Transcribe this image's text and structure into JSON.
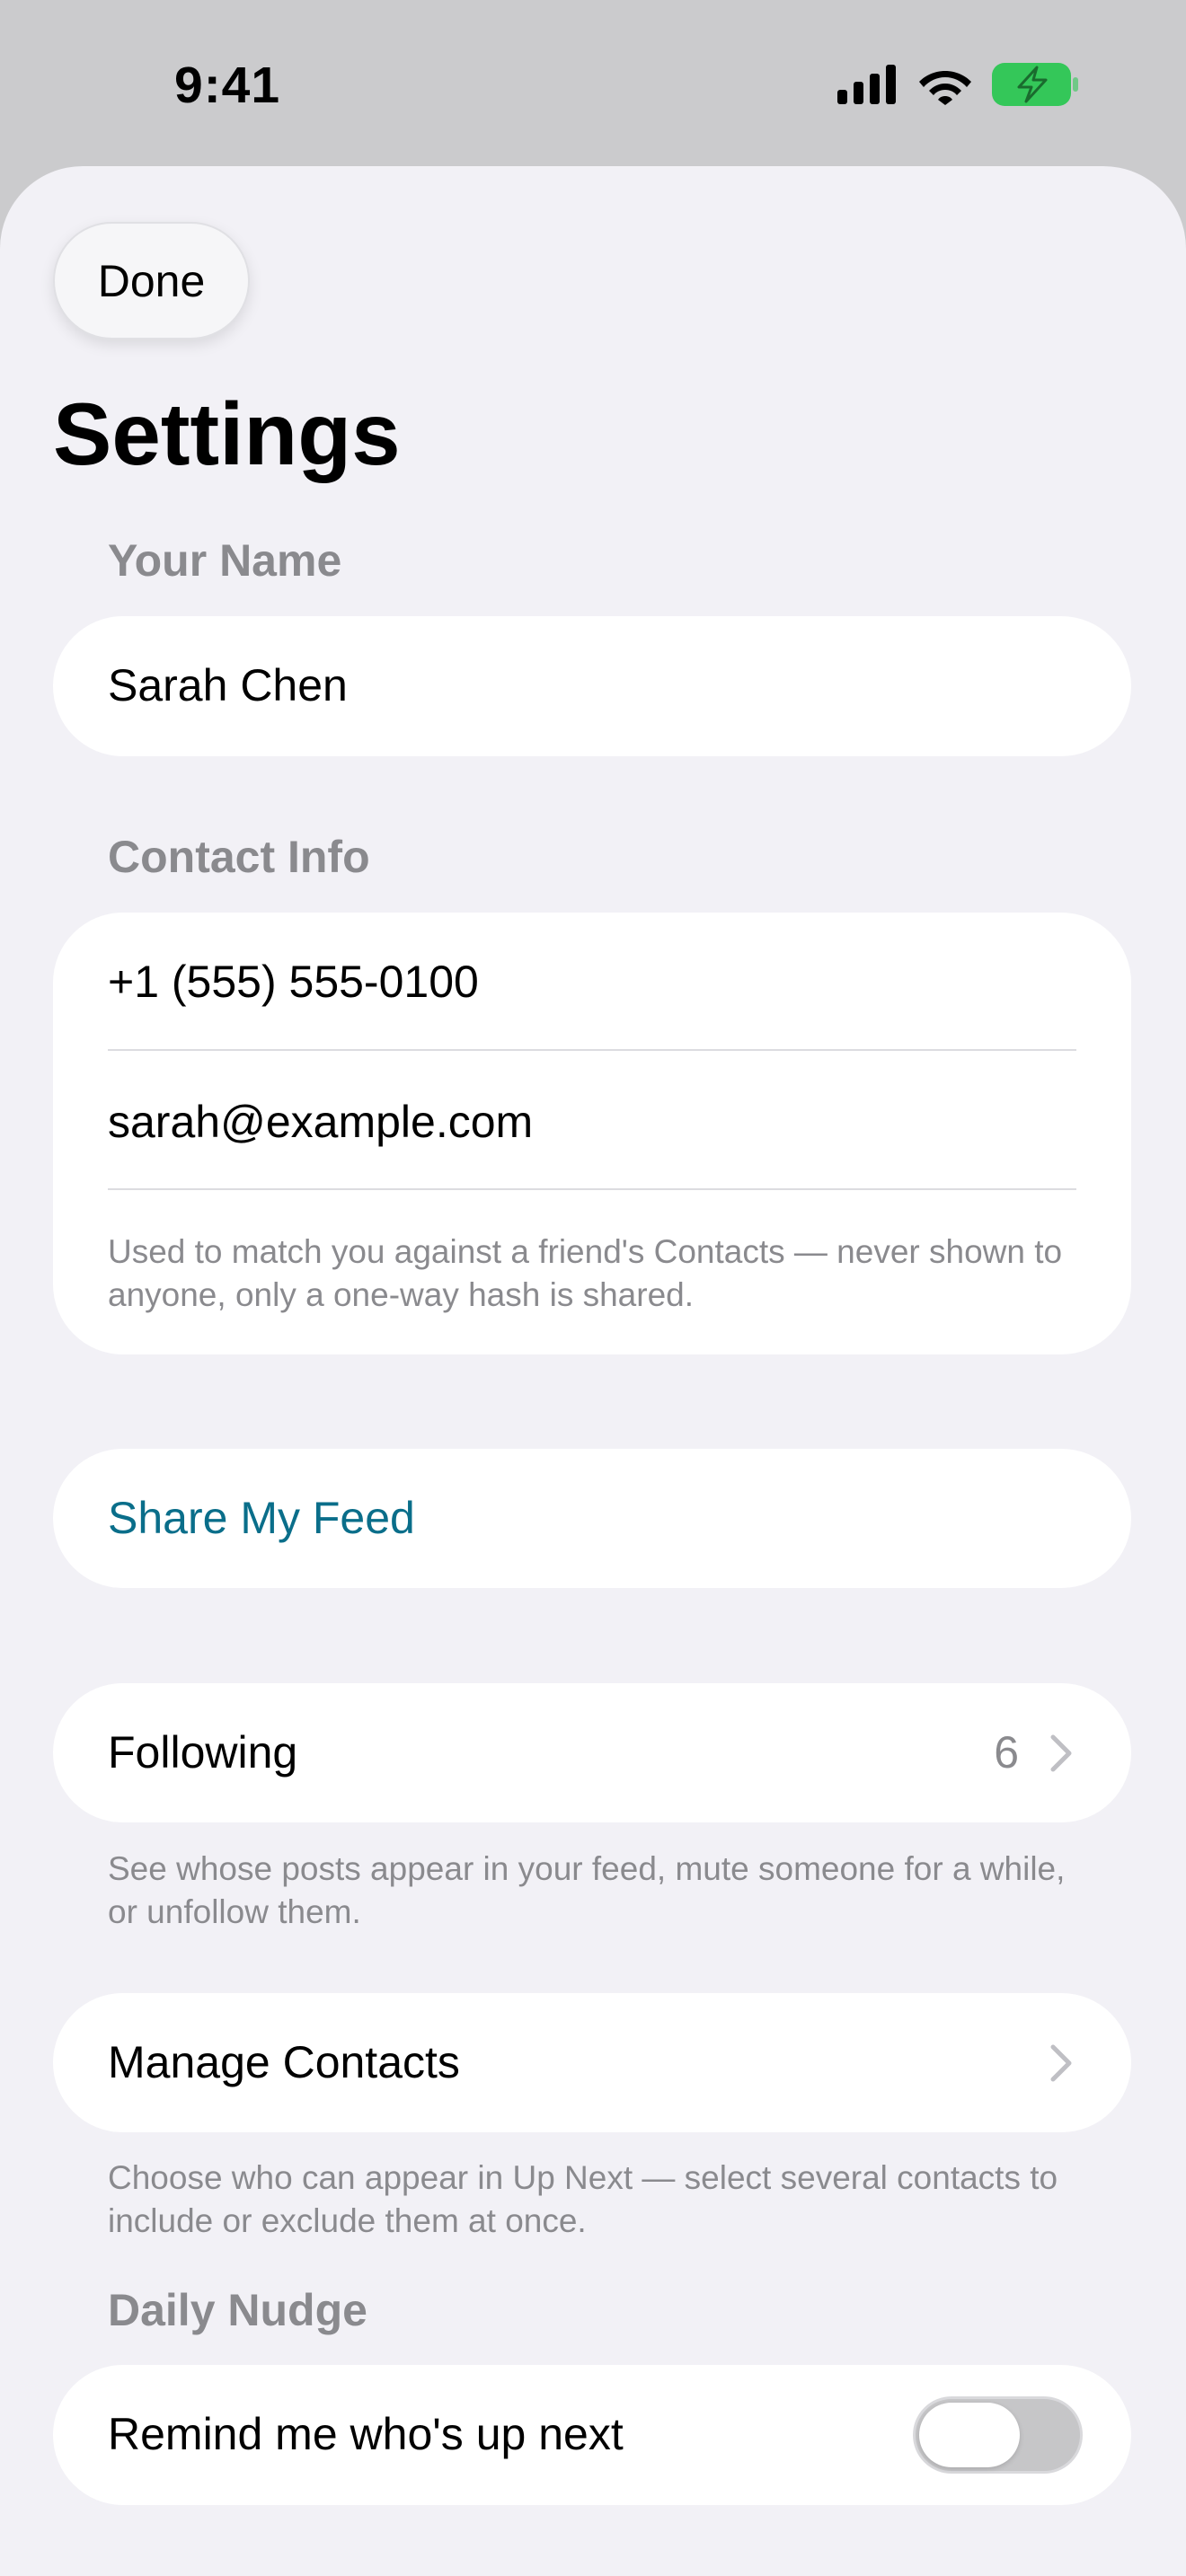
{
  "status_bar": {
    "time": "9:41",
    "icons": [
      "cellular-signal-icon",
      "wifi-icon",
      "battery-charging-icon"
    ],
    "battery_color": "#34c759"
  },
  "header": {
    "done_label": "Done",
    "title": "Settings"
  },
  "your_name": {
    "header": "Your Name",
    "value": "Sarah Chen"
  },
  "contact_info": {
    "header": "Contact Info",
    "phone": "+1 (555) 555-0100",
    "email": "sarah@example.com",
    "note": "Used to match you against a friend's Contacts — never shown to anyone, only a one-way hash is shared."
  },
  "share": {
    "label": "Share My Feed",
    "color": "#0a6e8a"
  },
  "following": {
    "label": "Following",
    "count": "6",
    "note": "See whose posts appear in your feed, mute someone for a while, or unfollow them."
  },
  "manage_contacts": {
    "label": "Manage Contacts",
    "note": "Choose who can appear in Up Next — select several contacts to include or exclude them at once."
  },
  "daily_nudge": {
    "header": "Daily Nudge",
    "label": "Remind me who's up next",
    "enabled": false
  }
}
